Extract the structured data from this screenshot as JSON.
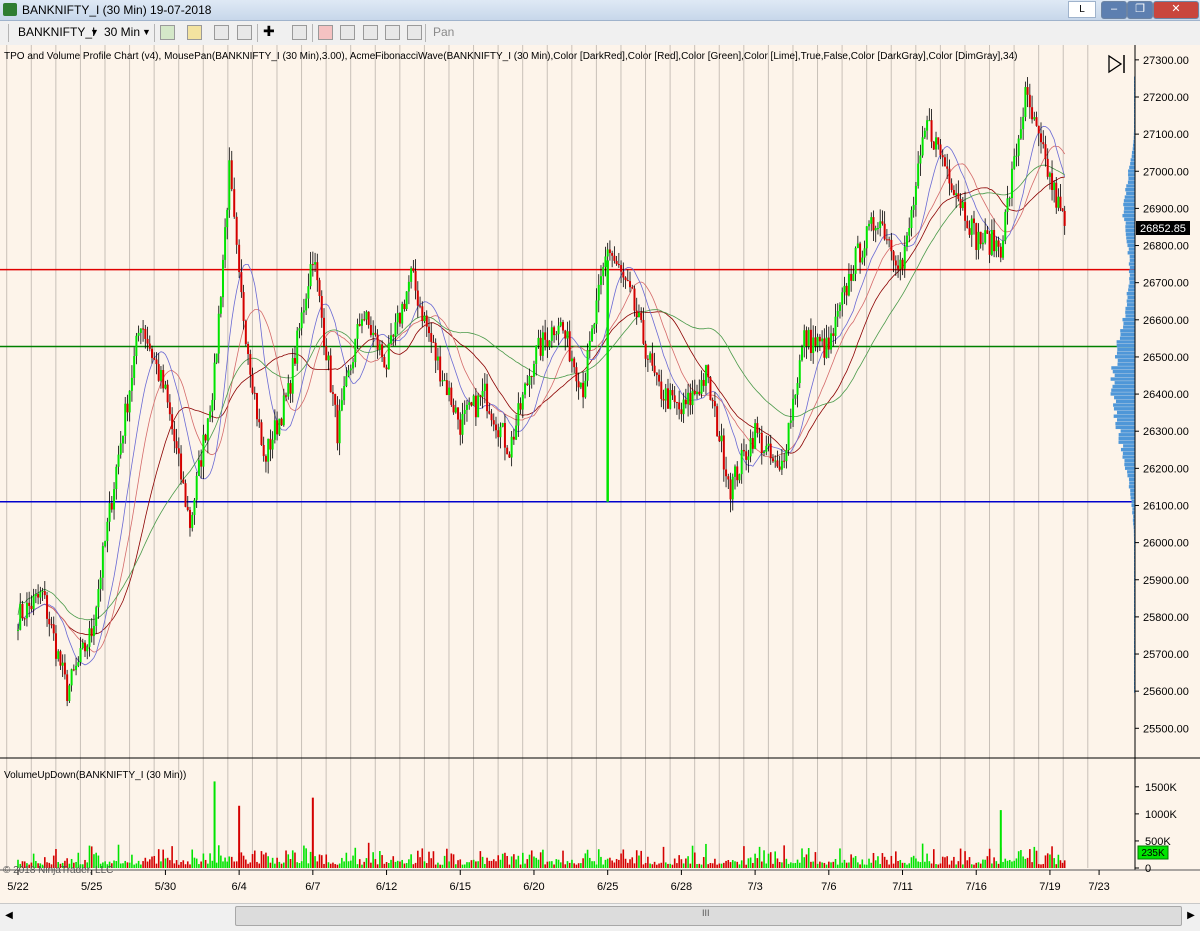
{
  "window": {
    "title": "BANKNIFTY_I (30 Min)  19-07-2018",
    "mode_button": "L"
  },
  "toolbar": {
    "instrument": "BANKNIFTY_I",
    "interval": "30 Min",
    "pan_label": "Pan"
  },
  "colors": {
    "background": "#fdf4ea",
    "up": "#00e400",
    "down": "#d40000",
    "red_line": "#e00000",
    "green_line": "#008000",
    "blue_line": "#0000cc"
  },
  "chart_data": [
    {
      "type": "candlestick",
      "title": "TPO and Volume Profile Chart (v4), MousePan(BANKNIFTY_I (30 Min),3.00), AcmeFibonacciWave(BANKNIFTY_I (30 Min),Color [DarkRed],Color [Red],Color [Green],Color [Lime],True,False,Color [DarkGray],Color [DimGray],34)",
      "ylim": [
        25420,
        27340
      ],
      "yticks": [
        25500,
        25600,
        25700,
        25800,
        25900,
        26000,
        26100,
        26200,
        26300,
        26400,
        26500,
        26600,
        26700,
        26800,
        26900,
        27000,
        27100,
        27200,
        27300
      ],
      "last_price": "26852.85",
      "horizontal_lines": [
        {
          "value": 26735,
          "color": "red"
        },
        {
          "value": 26528,
          "color": "green"
        },
        {
          "value": 26110,
          "color": "blue"
        }
      ],
      "price_path": [
        {
          "x": "5/22",
          "y": 25800
        },
        {
          "x": "5/23",
          "y": 25860
        },
        {
          "x": "5/24",
          "y": 25600
        },
        {
          "x": "5/25",
          "y": 25760
        },
        {
          "x": "5/28",
          "y": 26200
        },
        {
          "x": "5/29",
          "y": 26600
        },
        {
          "x": "5/30",
          "y": 26400
        },
        {
          "x": "5/31",
          "y": 26050
        },
        {
          "x": "6/1",
          "y": 26450
        },
        {
          "x": "6/1",
          "y": 27000
        },
        {
          "x": "6/4",
          "y": 26700
        },
        {
          "x": "6/5",
          "y": 26220
        },
        {
          "x": "6/6",
          "y": 26400
        },
        {
          "x": "6/7",
          "y": 26780
        },
        {
          "x": "6/8",
          "y": 26300
        },
        {
          "x": "6/11",
          "y": 26620
        },
        {
          "x": "6/12",
          "y": 26480
        },
        {
          "x": "6/13",
          "y": 26720
        },
        {
          "x": "6/14",
          "y": 26500
        },
        {
          "x": "6/15",
          "y": 26320
        },
        {
          "x": "6/18",
          "y": 26400
        },
        {
          "x": "6/19",
          "y": 26250
        },
        {
          "x": "6/20",
          "y": 26500
        },
        {
          "x": "6/21",
          "y": 26600
        },
        {
          "x": "6/22",
          "y": 26420
        },
        {
          "x": "6/25",
          "y": 26800
        },
        {
          "x": "6/26",
          "y": 26650
        },
        {
          "x": "6/27",
          "y": 26420
        },
        {
          "x": "6/28",
          "y": 26350
        },
        {
          "x": "6/29",
          "y": 26450
        },
        {
          "x": "7/2",
          "y": 26150
        },
        {
          "x": "7/3",
          "y": 26300
        },
        {
          "x": "7/4",
          "y": 26180
        },
        {
          "x": "7/5",
          "y": 26550
        },
        {
          "x": "7/6",
          "y": 26520
        },
        {
          "x": "7/9",
          "y": 26750
        },
        {
          "x": "7/10",
          "y": 26880
        },
        {
          "x": "7/11",
          "y": 26740
        },
        {
          "x": "7/12",
          "y": 27130
        },
        {
          "x": "7/13",
          "y": 26980
        },
        {
          "x": "7/16",
          "y": 26820
        },
        {
          "x": "7/17",
          "y": 26800
        },
        {
          "x": "7/18",
          "y": 27200
        },
        {
          "x": "7/19",
          "y": 26980
        },
        {
          "x": "7/19",
          "y": 26852.85
        }
      ]
    },
    {
      "type": "bar",
      "title": "VolumeUpDown(BANKNIFTY_I (30 Min))",
      "ylim": [
        0,
        1700
      ],
      "yticks": [
        "1500K",
        "1000K",
        "500K",
        "0"
      ],
      "last_value": "235K",
      "spike_values_k": [
        {
          "x": "6/1",
          "y": 1600
        },
        {
          "x": "6/4",
          "y": 1150
        },
        {
          "x": "6/7",
          "y": 1300
        },
        {
          "x": "7/17",
          "y": 1070
        }
      ]
    }
  ],
  "x_axis": {
    "labels": [
      "5/22",
      "5/25",
      "5/30",
      "6/4",
      "6/7",
      "6/12",
      "6/15",
      "6/20",
      "6/25",
      "6/28",
      "7/3",
      "7/6",
      "7/11",
      "7/16",
      "7/19",
      "7/23"
    ]
  },
  "copyright": "© 2018 NinjaTrader, LLC",
  "scrollbar": {
    "grip": "III"
  }
}
